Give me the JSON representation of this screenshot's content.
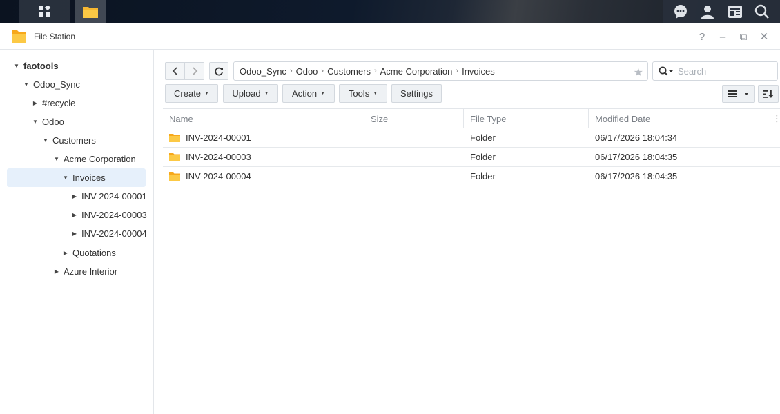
{
  "window": {
    "title": "File Station",
    "controls": [
      "?",
      "–",
      "⧉",
      "✕"
    ]
  },
  "sidebar": {
    "items": [
      {
        "label": "faotools",
        "depth": 0,
        "expanded": true,
        "root": true
      },
      {
        "label": "Odoo_Sync",
        "depth": 1,
        "expanded": true
      },
      {
        "label": "#recycle",
        "depth": 2,
        "expanded": false
      },
      {
        "label": "Odoo",
        "depth": 2,
        "expanded": true
      },
      {
        "label": "Customers",
        "depth": 3,
        "expanded": true
      },
      {
        "label": "Acme Corporation",
        "depth": 4,
        "expanded": true
      },
      {
        "label": "Invoices",
        "depth": 5,
        "expanded": true,
        "selected": true
      },
      {
        "label": "INV-2024-00001",
        "depth": 6,
        "expanded": false
      },
      {
        "label": "INV-2024-00003",
        "depth": 6,
        "expanded": false
      },
      {
        "label": "INV-2024-00004",
        "depth": 6,
        "expanded": false
      },
      {
        "label": "Quotations",
        "depth": 5,
        "expanded": false
      },
      {
        "label": "Azure Interior",
        "depth": 4,
        "expanded": false
      }
    ]
  },
  "path": {
    "segments": [
      "Odoo_Sync",
      "Odoo",
      "Customers",
      "Acme Corporation",
      "Invoices"
    ]
  },
  "search": {
    "placeholder": "Search",
    "value": ""
  },
  "toolbar": {
    "create": "Create",
    "upload": "Upload",
    "action": "Action",
    "tools": "Tools",
    "settings": "Settings"
  },
  "table": {
    "columns": {
      "name": "Name",
      "size": "Size",
      "type": "File Type",
      "modified": "Modified Date"
    },
    "rows": [
      {
        "name": "INV-2024-00001",
        "size": "",
        "type": "Folder",
        "modified": "06/17/2026 18:04:34"
      },
      {
        "name": "INV-2024-00003",
        "size": "",
        "type": "Folder",
        "modified": "06/17/2026 18:04:35"
      },
      {
        "name": "INV-2024-00004",
        "size": "",
        "type": "Folder",
        "modified": "06/17/2026 18:04:35"
      }
    ]
  },
  "colors": {
    "folder": "#f7b731",
    "selection": "#e6f0fb",
    "border": "#d3d8de"
  }
}
